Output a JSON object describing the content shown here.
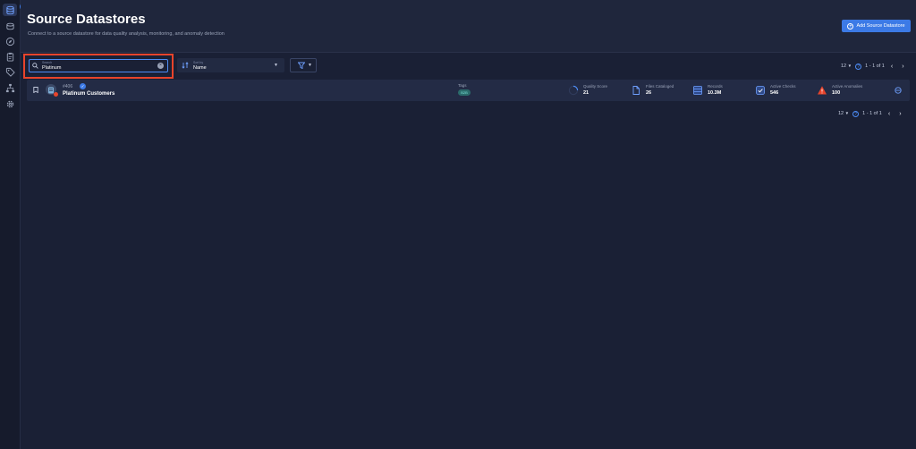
{
  "header": {
    "title": "Source Datastores",
    "subtitle": "Connect to a source datastore for data quality analysis, monitoring, and anomaly detection",
    "add_button_label": "Add Source Datastore"
  },
  "toolbar": {
    "search_label": "Search",
    "search_value": "Platinum",
    "sort_label": "Sort by",
    "sort_value": "Name"
  },
  "pagination_top": {
    "per_page": "12",
    "range": "1 - 1 of 1"
  },
  "pagination_bottom": {
    "per_page": "12",
    "range": "1 - 1 of 1"
  },
  "datastores": [
    {
      "id": "#406",
      "name": "Platinum Customers",
      "tags_label": "Tags",
      "tag": "B2B",
      "metrics": {
        "quality_score_label": "Quality Score",
        "quality_score": "21",
        "files_label": "Files Cataloged",
        "files": "26",
        "records_label": "Records",
        "records": "10.3M",
        "checks_label": "Active Checks",
        "checks": "546",
        "anomalies_label": "Active Anomalies",
        "anomalies": "100"
      }
    }
  ],
  "colors": {
    "accent": "#3c7ae6",
    "highlight": "#e8442b",
    "background": "#1a2035"
  }
}
